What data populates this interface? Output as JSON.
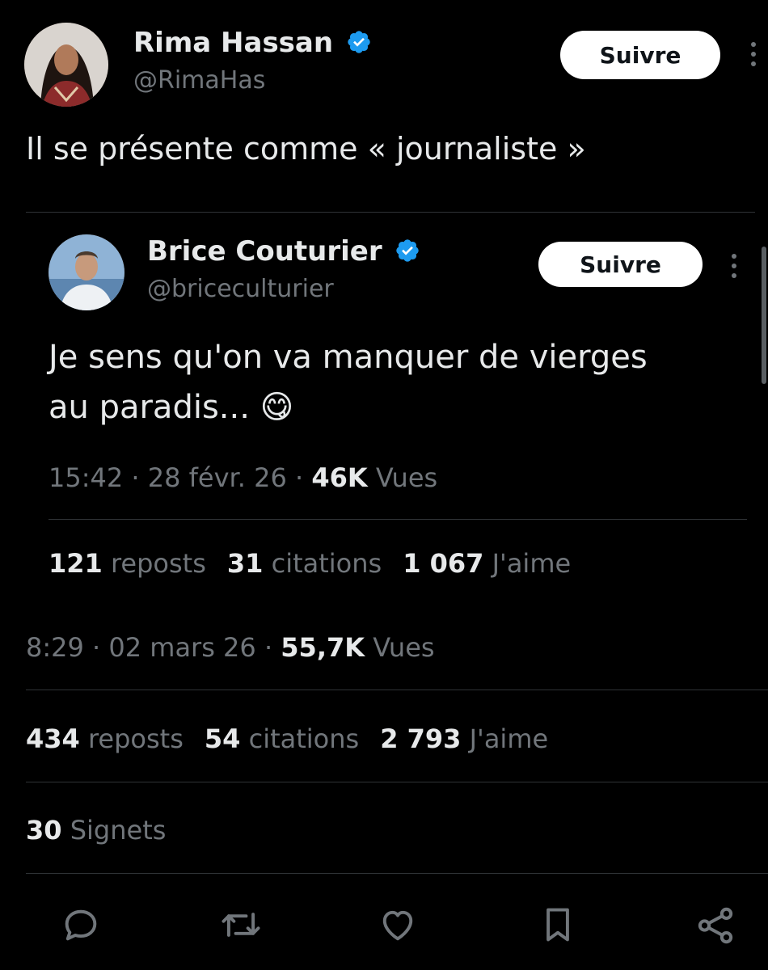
{
  "main_tweet": {
    "author_name": "Rima Hassan",
    "author_handle": "@RimaHas",
    "follow_label": "Suivre",
    "text": "Il se présente comme « journaliste »",
    "time": "8:29",
    "date": "02 mars 26",
    "views_count": "55,7K",
    "views_label": "Vues",
    "reposts_count": "434",
    "reposts_label": "reposts",
    "quotes_count": "54",
    "quotes_label": "citations",
    "likes_count": "2 793",
    "likes_label": "J'aime",
    "bookmarks_count": "30",
    "bookmarks_label": "Signets"
  },
  "quoted_tweet": {
    "author_name": "Brice Couturier",
    "author_handle": "@briceculturier",
    "follow_label": "Suivre",
    "text_line1": "Je sens qu'on va manquer de vierges",
    "text_line2": "au paradis...",
    "emoji": "😋",
    "time": "15:42",
    "date": "28 févr. 26",
    "views_count": "46K",
    "views_label": "Vues",
    "reposts_count": "121",
    "reposts_label": "reposts",
    "quotes_count": "31",
    "quotes_label": "citations",
    "likes_count": "1 067",
    "likes_label": "J'aime"
  },
  "meta_separator": "·",
  "colors": {
    "background": "#000000",
    "verified": "#1d9bf0",
    "muted": "#71767b",
    "divider": "#2f3336"
  },
  "actions": [
    "reply-icon",
    "repost-icon",
    "like-icon",
    "bookmark-icon",
    "share-icon"
  ]
}
